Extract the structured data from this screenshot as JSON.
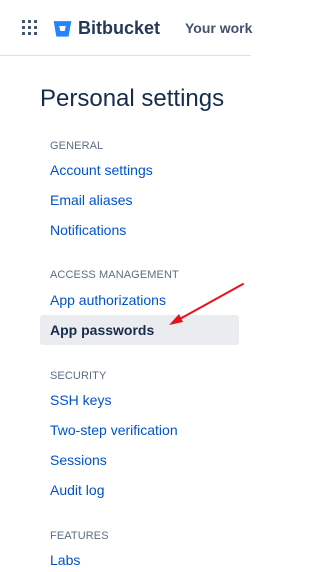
{
  "header": {
    "brand": "Bitbucket",
    "nav_link": "Your work",
    "brand_color": "#2684FF"
  },
  "page": {
    "title": "Personal settings"
  },
  "sections": [
    {
      "heading": "GENERAL",
      "items": [
        "Account settings",
        "Email aliases",
        "Notifications"
      ]
    },
    {
      "heading": "ACCESS MANAGEMENT",
      "items": [
        "App authorizations",
        "App passwords"
      ]
    },
    {
      "heading": "SECURITY",
      "items": [
        "SSH keys",
        "Two-step verification",
        "Sessions",
        "Audit log"
      ]
    },
    {
      "heading": "FEATURES",
      "items": [
        "Labs"
      ]
    }
  ],
  "active_item": "App passwords",
  "annotation": {
    "arrow_color": "#E8111A"
  },
  "colors": {
    "link": "#0052CC",
    "heading": "#5E6C84",
    "active_bg": "#EBECF0",
    "text": "#172B4D"
  }
}
